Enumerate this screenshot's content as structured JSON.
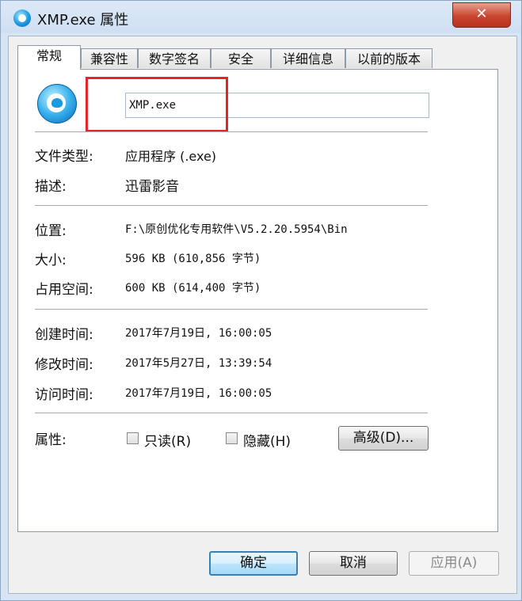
{
  "window": {
    "title": "XMP.exe 属性",
    "close_label": "✕"
  },
  "tabs": [
    "常规",
    "兼容性",
    "数字签名",
    "安全",
    "详细信息",
    "以前的版本"
  ],
  "file_name": "XMP.exe",
  "fields": {
    "type": {
      "label": "文件类型:",
      "value": "应用程序 (.exe)"
    },
    "desc": {
      "label": "描述:",
      "value": "迅雷影音"
    },
    "location": {
      "label": "位置:",
      "value": "F:\\原创优化专用软件\\V5.2.20.5954\\Bin"
    },
    "size": {
      "label": "大小:",
      "value": "596 KB (610,856 字节)"
    },
    "disk_size": {
      "label": "占用空间:",
      "value": "600 KB (614,400 字节)"
    },
    "created": {
      "label": "创建时间:",
      "value": "2017年7月19日, 16:00:05"
    },
    "modified": {
      "label": "修改时间:",
      "value": "2017年5月27日, 13:39:54"
    },
    "accessed": {
      "label": "访问时间:",
      "value": "2017年7月19日, 16:00:05"
    }
  },
  "attributes": {
    "label": "属性:",
    "readonly": {
      "label": "只读(R)",
      "checked": false
    },
    "hidden": {
      "label": "隐藏(H)",
      "checked": false
    },
    "advanced_label": "高级(D)..."
  },
  "buttons": {
    "ok": "确定",
    "cancel": "取消",
    "apply": "应用(A)"
  },
  "colors": {
    "highlight_box": "#e0262c",
    "default_button_border": "#3c7fb1"
  }
}
